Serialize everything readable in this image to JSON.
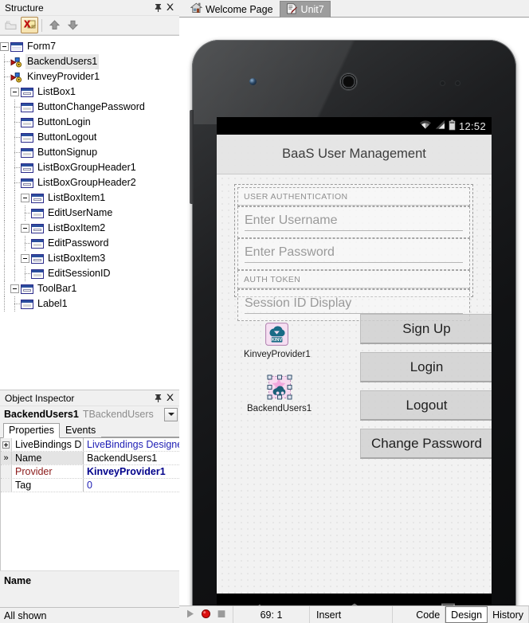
{
  "structure_panel": {
    "title": "Structure",
    "pin_icon": "pin-icon",
    "close_icon": "close-icon",
    "toolbar": [
      {
        "name": "new-item-icon",
        "label": ""
      },
      {
        "name": "delete-item-icon",
        "label": ""
      },
      {
        "name": "move-up-icon",
        "label": ""
      },
      {
        "name": "move-down-icon",
        "label": ""
      }
    ],
    "tree": [
      {
        "label": "Form7",
        "depth": 0,
        "icon": "form-icon",
        "expander": true,
        "selected": false
      },
      {
        "label": "BackendUsers1",
        "depth": 1,
        "icon": "provider-icon",
        "expander": false,
        "selected": true
      },
      {
        "label": "KinveyProvider1",
        "depth": 1,
        "icon": "provider-icon",
        "expander": false,
        "selected": false
      },
      {
        "label": "ListBox1",
        "depth": 1,
        "icon": "panel-icon",
        "expander": true,
        "selected": false
      },
      {
        "label": "ButtonChangePassword",
        "depth": 2,
        "icon": "control-icon",
        "expander": false,
        "selected": false
      },
      {
        "label": "ButtonLogin",
        "depth": 2,
        "icon": "control-icon",
        "expander": false,
        "selected": false
      },
      {
        "label": "ButtonLogout",
        "depth": 2,
        "icon": "control-icon",
        "expander": false,
        "selected": false
      },
      {
        "label": "ButtonSignup",
        "depth": 2,
        "icon": "control-icon",
        "expander": false,
        "selected": false
      },
      {
        "label": "ListBoxGroupHeader1",
        "depth": 2,
        "icon": "panel-icon",
        "expander": false,
        "selected": false
      },
      {
        "label": "ListBoxGroupHeader2",
        "depth": 2,
        "icon": "panel-icon",
        "expander": false,
        "selected": false
      },
      {
        "label": "ListBoxItem1",
        "depth": 2,
        "icon": "panel-icon",
        "expander": true,
        "selected": false
      },
      {
        "label": "EditUserName",
        "depth": 3,
        "icon": "control-icon",
        "expander": false,
        "selected": false
      },
      {
        "label": "ListBoxItem2",
        "depth": 2,
        "icon": "panel-icon",
        "expander": true,
        "selected": false
      },
      {
        "label": "EditPassword",
        "depth": 3,
        "icon": "control-icon",
        "expander": false,
        "selected": false
      },
      {
        "label": "ListBoxItem3",
        "depth": 2,
        "icon": "panel-icon",
        "expander": true,
        "selected": false
      },
      {
        "label": "EditSessionID",
        "depth": 3,
        "icon": "control-icon",
        "expander": false,
        "selected": false
      },
      {
        "label": "ToolBar1",
        "depth": 1,
        "icon": "panel-icon",
        "expander": true,
        "selected": false
      },
      {
        "label": "Label1",
        "depth": 2,
        "icon": "control-icon",
        "expander": false,
        "selected": false
      }
    ]
  },
  "object_inspector": {
    "title": "Object Inspector",
    "pin_icon": "pin-icon",
    "close_icon": "close-icon",
    "selected_name": "BackendUsers1",
    "selected_class": "TBackendUsers",
    "dropdown_icon": "chevron-down-icon",
    "tabs": [
      {
        "label": "Properties",
        "active": true
      },
      {
        "label": "Events",
        "active": false
      }
    ],
    "rows": [
      {
        "name": "LiveBindings D",
        "value": "LiveBindings Designer",
        "gutter": "plus",
        "name_color": "black",
        "value_color": "blue",
        "selected": false
      },
      {
        "name": "Name",
        "value": "BackendUsers1",
        "gutter": "»",
        "name_color": "black",
        "value_color": "black",
        "selected": true
      },
      {
        "name": "Provider",
        "value": "KinveyProvider1",
        "gutter": "",
        "name_color": "red",
        "value_color": "navy",
        "selected": false
      },
      {
        "name": "Tag",
        "value": "0",
        "gutter": "",
        "name_color": "black",
        "value_color": "blue",
        "selected": false
      }
    ],
    "description": "Name",
    "status": "All shown"
  },
  "file_tabs": [
    {
      "label": "Welcome Page",
      "icon": "home-icon",
      "active": false
    },
    {
      "label": "Unit7",
      "icon": "unit-file-icon",
      "active": true
    }
  ],
  "device": {
    "camera_icon": "front-camera-icon",
    "speaker_icon": "earpiece-speaker-icon",
    "sensor_icon": "proximity-sensor-icon",
    "volume_button_icon": "volume-rocker-icon",
    "status_bar": {
      "wifi_icon": "wifi-icon",
      "signal_icon": "cellular-signal-icon",
      "battery_icon": "battery-icon",
      "clock": "12:52"
    },
    "nav_bar": [
      {
        "name": "back-icon"
      },
      {
        "name": "home-icon"
      },
      {
        "name": "recents-icon"
      }
    ]
  },
  "form": {
    "toolbar_label": "BaaS User Management",
    "group_header_1": "USER AUTHENTICATION",
    "group_header_2": "AUTH TOKEN",
    "edit_username_placeholder": "Enter Username",
    "edit_password_placeholder": "Enter Password",
    "edit_session_placeholder": "Session ID Display",
    "buttons": [
      {
        "label": "Sign Up"
      },
      {
        "label": "Login"
      },
      {
        "label": "Logout"
      },
      {
        "label": "Change Password"
      }
    ],
    "components": [
      {
        "label": "KinveyProvider1",
        "icon": "kinvey-cloud-icon",
        "icon_text": "KINV",
        "selected": false
      },
      {
        "label": "BackendUsers1",
        "icon": "backend-users-icon",
        "icon_text": "",
        "selected": true
      }
    ]
  },
  "ide_status": {
    "run_icon": "run-icon",
    "breakpoint_icon": "breakpoint-icon",
    "stop_icon": "stop-icon",
    "cursor_position": "69:  1",
    "insert_mode": "Insert",
    "view_tabs": [
      {
        "label": "Code",
        "active": false
      },
      {
        "label": "Design",
        "active": true
      },
      {
        "label": "History",
        "active": false
      }
    ]
  }
}
